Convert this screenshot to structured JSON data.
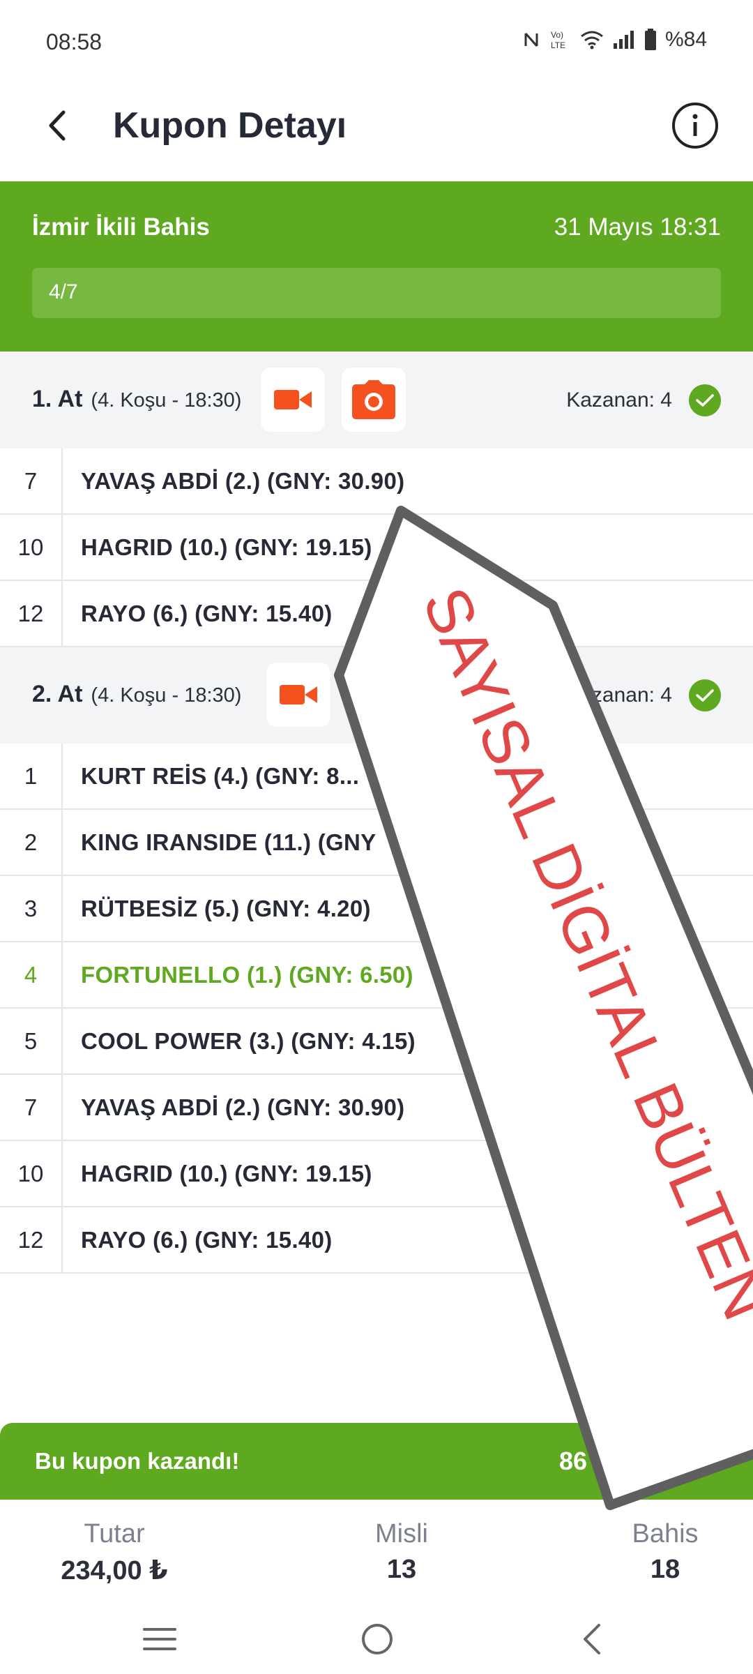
{
  "status_bar": {
    "time": "08:58",
    "battery": "%84"
  },
  "header": {
    "title": "Kupon Detayı"
  },
  "bet": {
    "type": "İzmir İkili Bahis",
    "date": "31 Mayıs 18:31",
    "progress_label": "4/7",
    "progress_fraction": 0.571
  },
  "sections": [
    {
      "title": "1. At",
      "subtitle": "(4. Koşu - 18:30)",
      "winner": "Kazanan: 4",
      "rows": [
        {
          "num": "7",
          "name": "YAVAŞ ABDİ (2.) (GNY: 30.90)"
        },
        {
          "num": "10",
          "name": "HAGRID (10.) (GNY: 19.15)"
        },
        {
          "num": "12",
          "name": "RAYO (6.) (GNY: 15.40)"
        }
      ]
    },
    {
      "title": "2. At",
      "subtitle": "(4. Koşu - 18:30)",
      "winner": "Kazanan: 4",
      "rows": [
        {
          "num": "1",
          "name": "KURT REİS (4.) (GNY: 8..."
        },
        {
          "num": "2",
          "name": "KING IRANSIDE (11.) (GNY"
        },
        {
          "num": "3",
          "name": "RÜTBESİZ (5.) (GNY: 4.20)"
        },
        {
          "num": "4",
          "name": "FORTUNELLO (1.) (GNY: 6.50)"
        },
        {
          "num": "5",
          "name": "COOL POWER (3.) (GNY: 4.15)"
        },
        {
          "num": "7",
          "name": "YAVAŞ ABDİ (2.) (GNY: 30.90)"
        },
        {
          "num": "10",
          "name": "HAGRID (10.) (GNY: 19.15)"
        },
        {
          "num": "12",
          "name": "RAYO (6.) (GNY: 15.40)"
        }
      ]
    }
  ],
  "banner": {
    "text": "Bu kupon kazandı!",
    "amount": "86"
  },
  "summary": {
    "tutar_label": "Tutar",
    "tutar_value": "234,00 ₺",
    "misli_label": "Misli",
    "misli_value": "13",
    "bahis_label": "Bahis",
    "bahis_value": "18"
  },
  "watermark": {
    "text": "SAYISAL DİGİTAL BÜLTEN"
  },
  "colors": {
    "brand_green": "#5ea91f",
    "camera_orange": "#f4511e",
    "watermark_red": "#e04848"
  }
}
